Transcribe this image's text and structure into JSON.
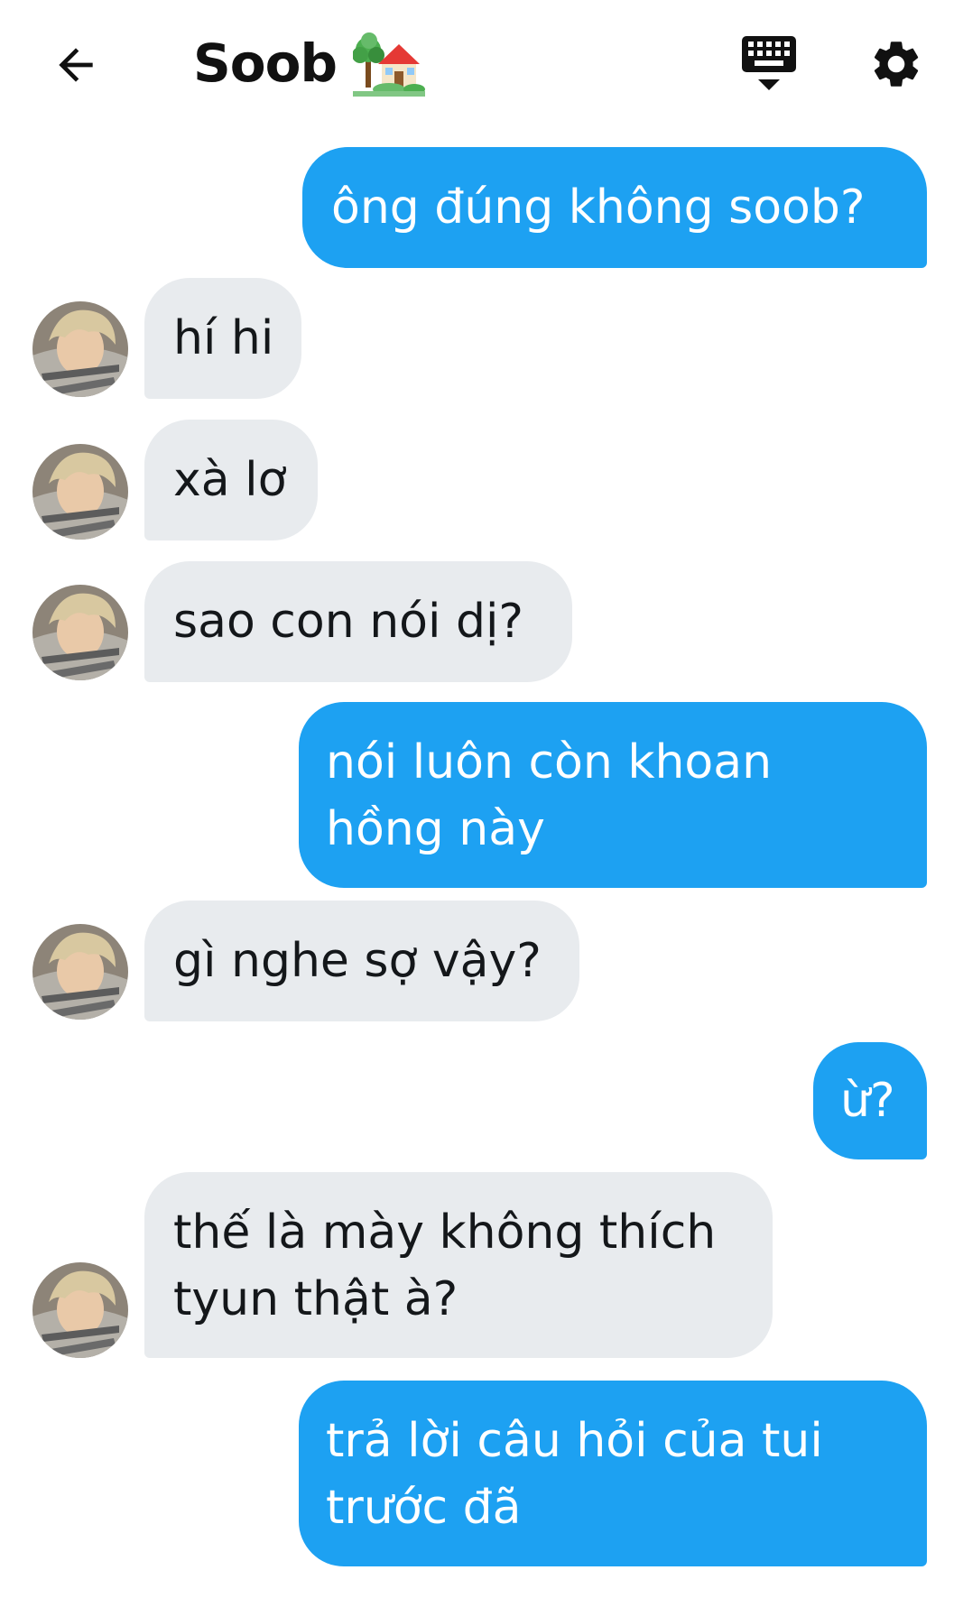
{
  "header": {
    "back_icon": "arrow-left-icon",
    "title": "Soob",
    "title_emoji": "house-with-garden-emoji",
    "keyboard_icon": "keyboard-icon",
    "settings_icon": "gear-icon"
  },
  "colors": {
    "outgoing_bubble": "#1da1f2",
    "incoming_bubble": "#e8ebee",
    "text_dark": "#14171a",
    "text_light": "#ffffff"
  },
  "messages": [
    {
      "direction": "out",
      "lines": [
        "ông đúng không soob?"
      ]
    },
    {
      "direction": "in",
      "lines": [
        "hí hi"
      ]
    },
    {
      "direction": "in",
      "lines": [
        "xà lơ"
      ]
    },
    {
      "direction": "in",
      "lines": [
        "sao con nói dị?"
      ]
    },
    {
      "direction": "out",
      "lines": [
        "nói luôn còn khoan",
        "hồng này"
      ]
    },
    {
      "direction": "in",
      "lines": [
        "gì nghe sợ vậy?"
      ]
    },
    {
      "direction": "out",
      "lines": [
        "ừ?"
      ]
    },
    {
      "direction": "in",
      "lines": [
        "thế là mày không thích",
        "tyun thật à?"
      ]
    },
    {
      "direction": "out",
      "lines": [
        "trả lời câu hỏi của tui",
        "trước đã"
      ]
    }
  ]
}
